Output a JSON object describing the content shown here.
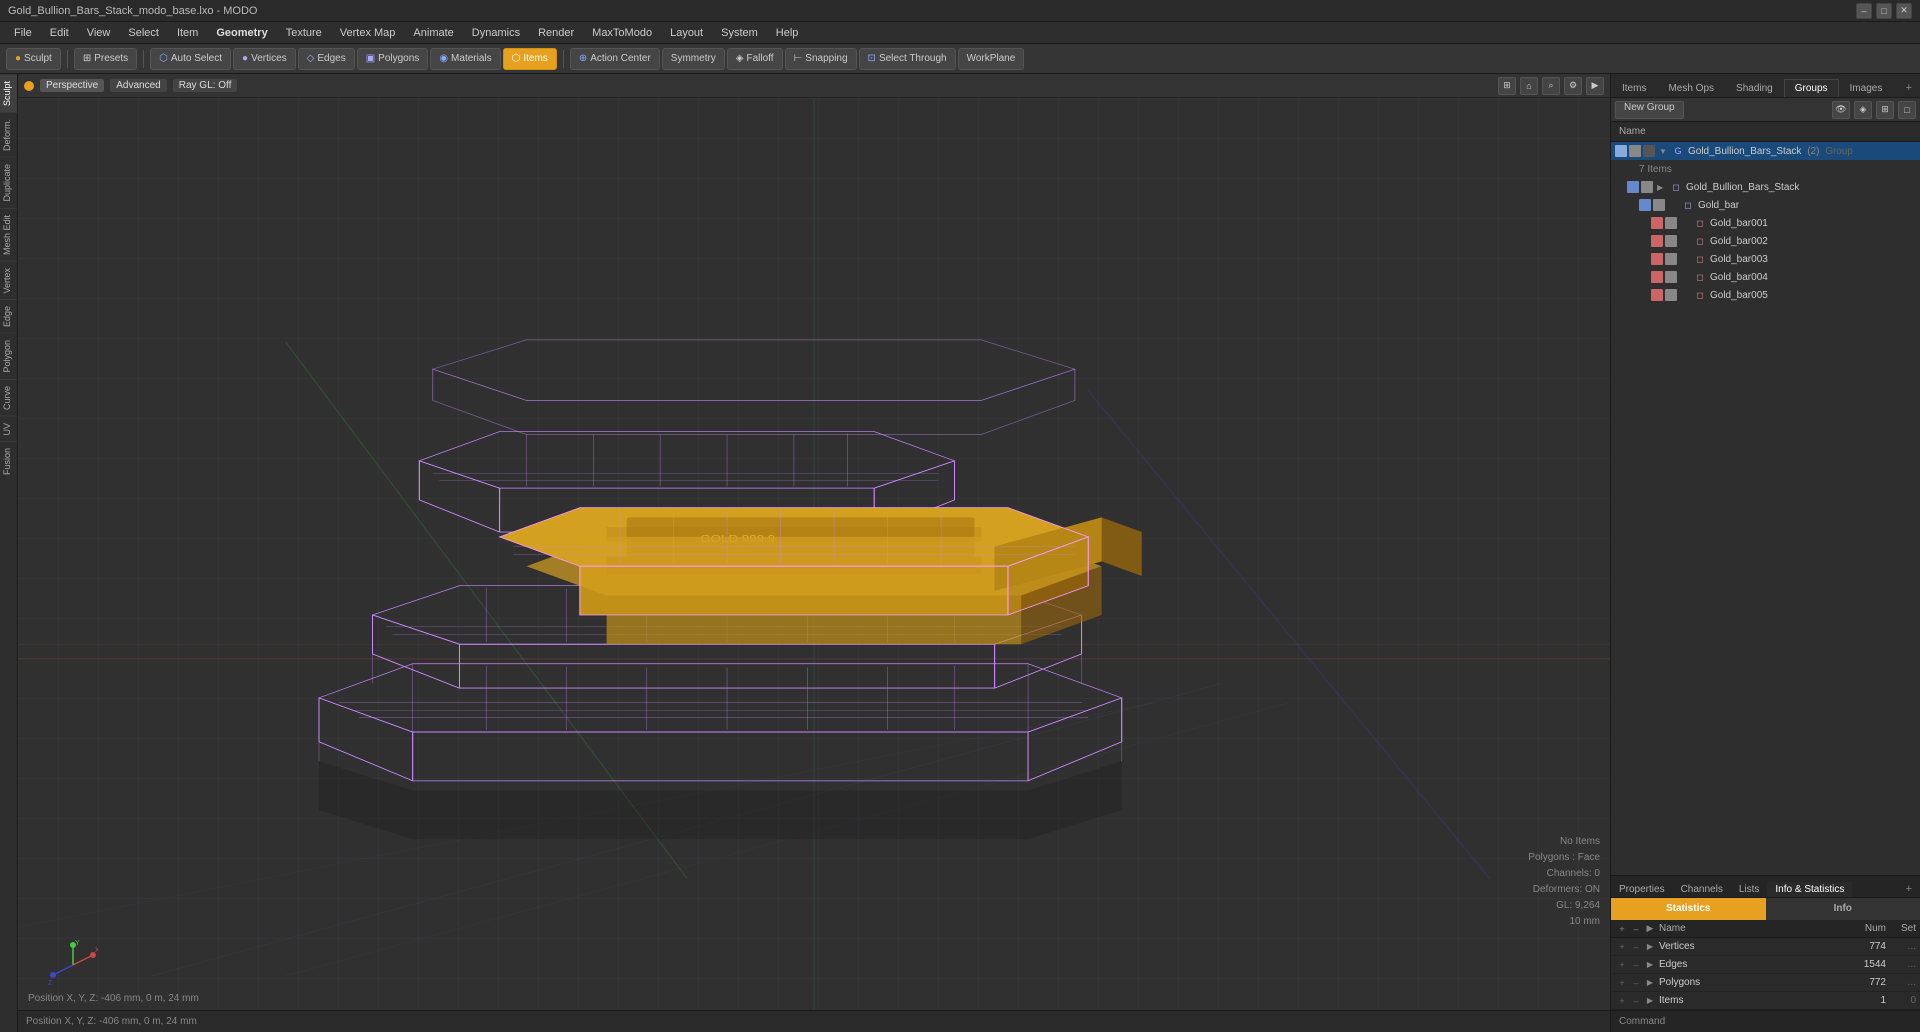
{
  "titlebar": {
    "title": "Gold_Bullion_Bars_Stack_modo_base.lxo - MODO",
    "minimize": "–",
    "maximize": "□",
    "close": "✕"
  },
  "menubar": {
    "items": [
      "File",
      "Edit",
      "View",
      "Select",
      "Item",
      "Geometry",
      "Texture",
      "Vertex Map",
      "Animate",
      "Dynamics",
      "Render",
      "MaxToModo",
      "Layout",
      "System",
      "Help"
    ]
  },
  "toolbar": {
    "sculpt": "Sculpt",
    "presets": "Presets",
    "autoselect": "Auto Select",
    "vertices_label": "Vertices",
    "edges_label": "Edges",
    "polygons_label": "Polygons",
    "materials_label": "Materials",
    "items_label": "Items",
    "action_center_label": "Action Center",
    "symmetry_label": "Symmetry",
    "falloff_label": "Falloff",
    "snapping_label": "Snapping",
    "select_through_label": "Select Through",
    "workplane_label": "WorkPlane"
  },
  "viewport": {
    "mode": "Perspective",
    "shading": "Advanced",
    "raygl": "Ray GL: Off",
    "overlay_no_items": "No Items",
    "overlay_polygons": "Polygons : Face",
    "overlay_channels": "Channels: 0",
    "overlay_deformers": "Deformers: ON",
    "overlay_gl": "GL: 9,264",
    "overlay_gl2": "10 mm",
    "position": "Position X, Y, Z:  -406 mm, 0 m, 24 mm"
  },
  "right_panel": {
    "tabs": [
      "Items",
      "Mesh Ops",
      "Shading",
      "Groups",
      "Images"
    ],
    "active_tab": "Groups",
    "new_group_label": "New Group",
    "col_name": "Name",
    "group_name": "Gold_Bullion_Bars_Stack",
    "group_count": "(2)",
    "group_type": "Group",
    "items_count": "7 Items",
    "tree_items": [
      {
        "label": "Gold_Bullion_Bars_Stack",
        "indent": 1,
        "type": "mesh",
        "color": "#aaaaff"
      },
      {
        "label": "Gold_bar",
        "indent": 2,
        "type": "mesh",
        "color": "#aaaaff"
      },
      {
        "label": "Gold_bar001",
        "indent": 3,
        "type": "mesh",
        "color": "#dd8888"
      },
      {
        "label": "Gold_bar002",
        "indent": 3,
        "type": "mesh",
        "color": "#dd8888"
      },
      {
        "label": "Gold_bar003",
        "indent": 3,
        "type": "mesh",
        "color": "#dd8888"
      },
      {
        "label": "Gold_bar004",
        "indent": 3,
        "type": "mesh",
        "color": "#dd8888"
      },
      {
        "label": "Gold_bar005",
        "indent": 3,
        "type": "mesh",
        "color": "#dd8888"
      }
    ]
  },
  "stats": {
    "tabs": [
      "Properties",
      "Channels",
      "Lists",
      "Info & Statistics"
    ],
    "active_tab": "Info & Statistics",
    "plus_tab": "+",
    "header_statistics": "Statistics",
    "header_info": "Info",
    "active_header": "Statistics",
    "col_name": "Name",
    "col_num": "Num",
    "col_set": "Set",
    "rows": [
      {
        "name": "Vertices",
        "num": "774",
        "set": "..."
      },
      {
        "name": "Edges",
        "num": "1544",
        "set": "..."
      },
      {
        "name": "Polygons",
        "num": "772",
        "set": "..."
      },
      {
        "name": "Items",
        "num": "1",
        "set": "0"
      }
    ]
  },
  "command_bar": {
    "label": "Command"
  },
  "left_tabs": [
    "Sculpt",
    "Deform.",
    "Duplicate",
    "Mesh Edit",
    "Vertex",
    "Edge",
    "Polygon",
    "Curve",
    "UV",
    "Fusion"
  ]
}
